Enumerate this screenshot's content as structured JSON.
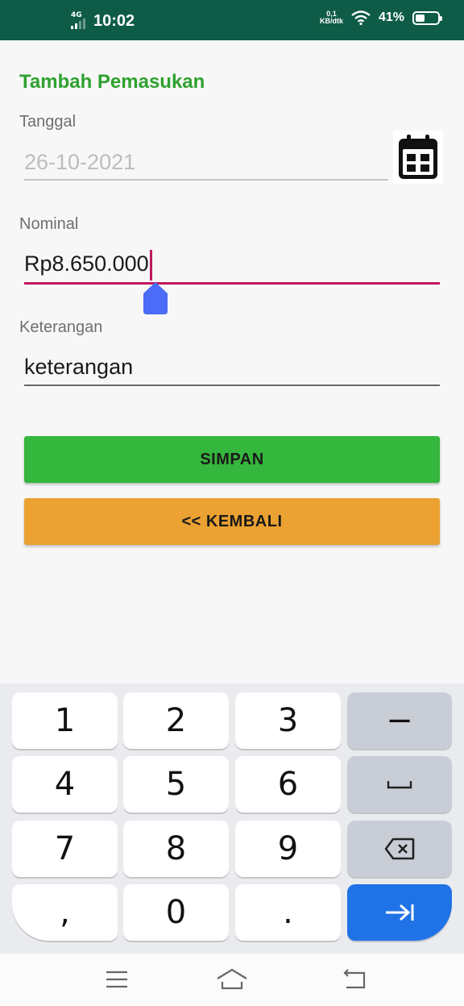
{
  "status_bar": {
    "network": "4G",
    "time": "10:02",
    "speed_value": "0,1",
    "speed_unit": "KB/dtk",
    "battery_percent": "41%",
    "battery_level": 0.41
  },
  "form": {
    "title": "Tambah Pemasukan",
    "date": {
      "label": "Tanggal",
      "value": "26-10-2021",
      "icon": "calendar-icon"
    },
    "nominal": {
      "label": "Nominal",
      "value": "Rp8.650.000"
    },
    "description": {
      "label": "Keterangan",
      "value": "keterangan"
    },
    "save_button": "SIMPAN",
    "back_button": "<< KEMBALI"
  },
  "keyboard": {
    "rows": [
      [
        "1",
        "2",
        "3",
        "−"
      ],
      [
        "4",
        "5",
        "6",
        "space-icon"
      ],
      [
        "7",
        "8",
        "9",
        "backspace-icon"
      ],
      [
        ",",
        "0",
        ".",
        "next-icon"
      ]
    ]
  },
  "nav_bar": {
    "icons": [
      "menu-icon",
      "home-icon",
      "back-icon"
    ]
  },
  "colors": {
    "status_bar": "#0e5c47",
    "title": "#2ea12e",
    "focus_underline": "#c2185b",
    "save_button": "#35b63c",
    "back_button": "#eba232",
    "enter_key": "#1f73e6"
  }
}
